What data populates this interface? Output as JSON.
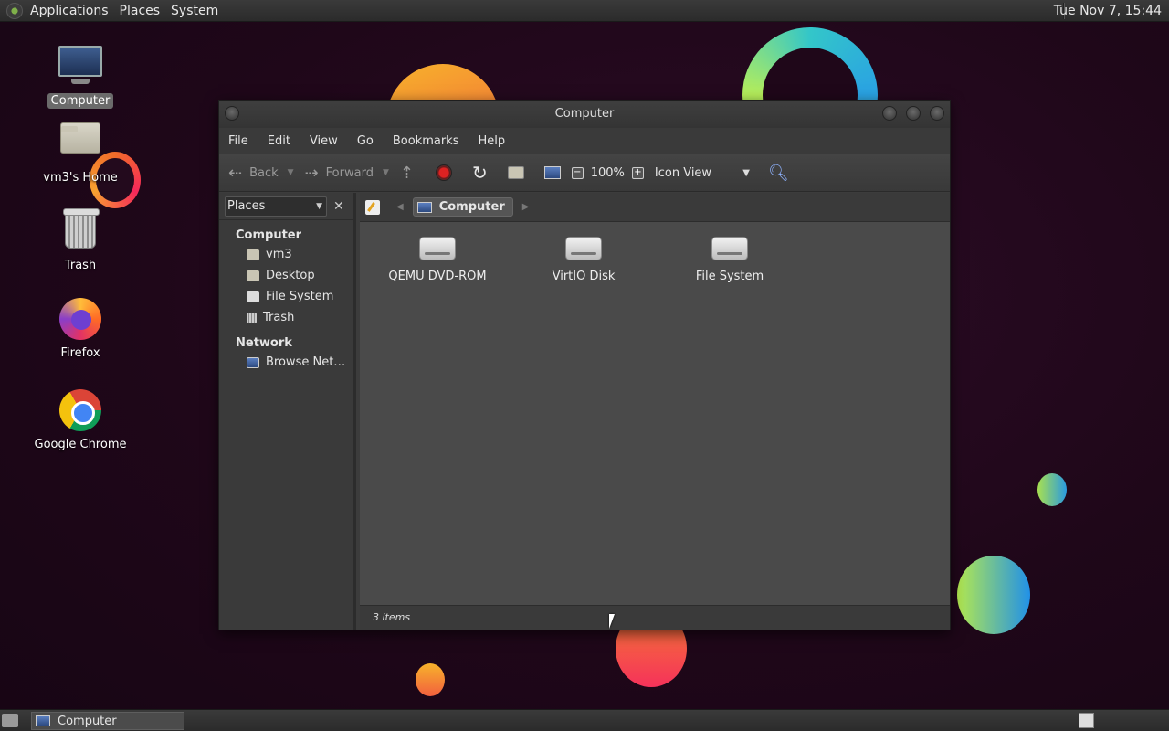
{
  "top_panel": {
    "menus": [
      "Applications",
      "Places",
      "System"
    ],
    "clock": "Tue Nov 7, 15:44"
  },
  "desktop": {
    "icons": [
      {
        "label": "Computer",
        "icon": "computer-icon",
        "selected": true
      },
      {
        "label": "vm3's Home",
        "icon": "home-folder-icon"
      },
      {
        "label": "Trash",
        "icon": "trash-icon"
      },
      {
        "label": "Firefox",
        "icon": "firefox-icon"
      },
      {
        "label": "Google Chrome",
        "icon": "chrome-icon"
      }
    ]
  },
  "window": {
    "title": "Computer",
    "menubar": [
      "File",
      "Edit",
      "View",
      "Go",
      "Bookmarks",
      "Help"
    ],
    "toolbar": {
      "back": "Back",
      "forward": "Forward",
      "zoom": "100%",
      "view_mode": "Icon View"
    },
    "sidebar": {
      "selector": "Places",
      "groups": [
        {
          "title": "Computer",
          "items": [
            "vm3",
            "Desktop",
            "File System",
            "Trash"
          ]
        },
        {
          "title": "Network",
          "items": [
            "Browse Net…"
          ]
        }
      ]
    },
    "pathbar": {
      "current": "Computer"
    },
    "files": [
      "QEMU DVD-ROM",
      "VirtIO Disk",
      "File System"
    ],
    "status": "3 items"
  },
  "taskbar": {
    "tasks": [
      "Computer"
    ]
  },
  "colors": {
    "desktop_bg": "#1f0719",
    "panel": "#333333",
    "window_bg": "#3c3c3c",
    "content_bg": "#4a4a4a"
  }
}
